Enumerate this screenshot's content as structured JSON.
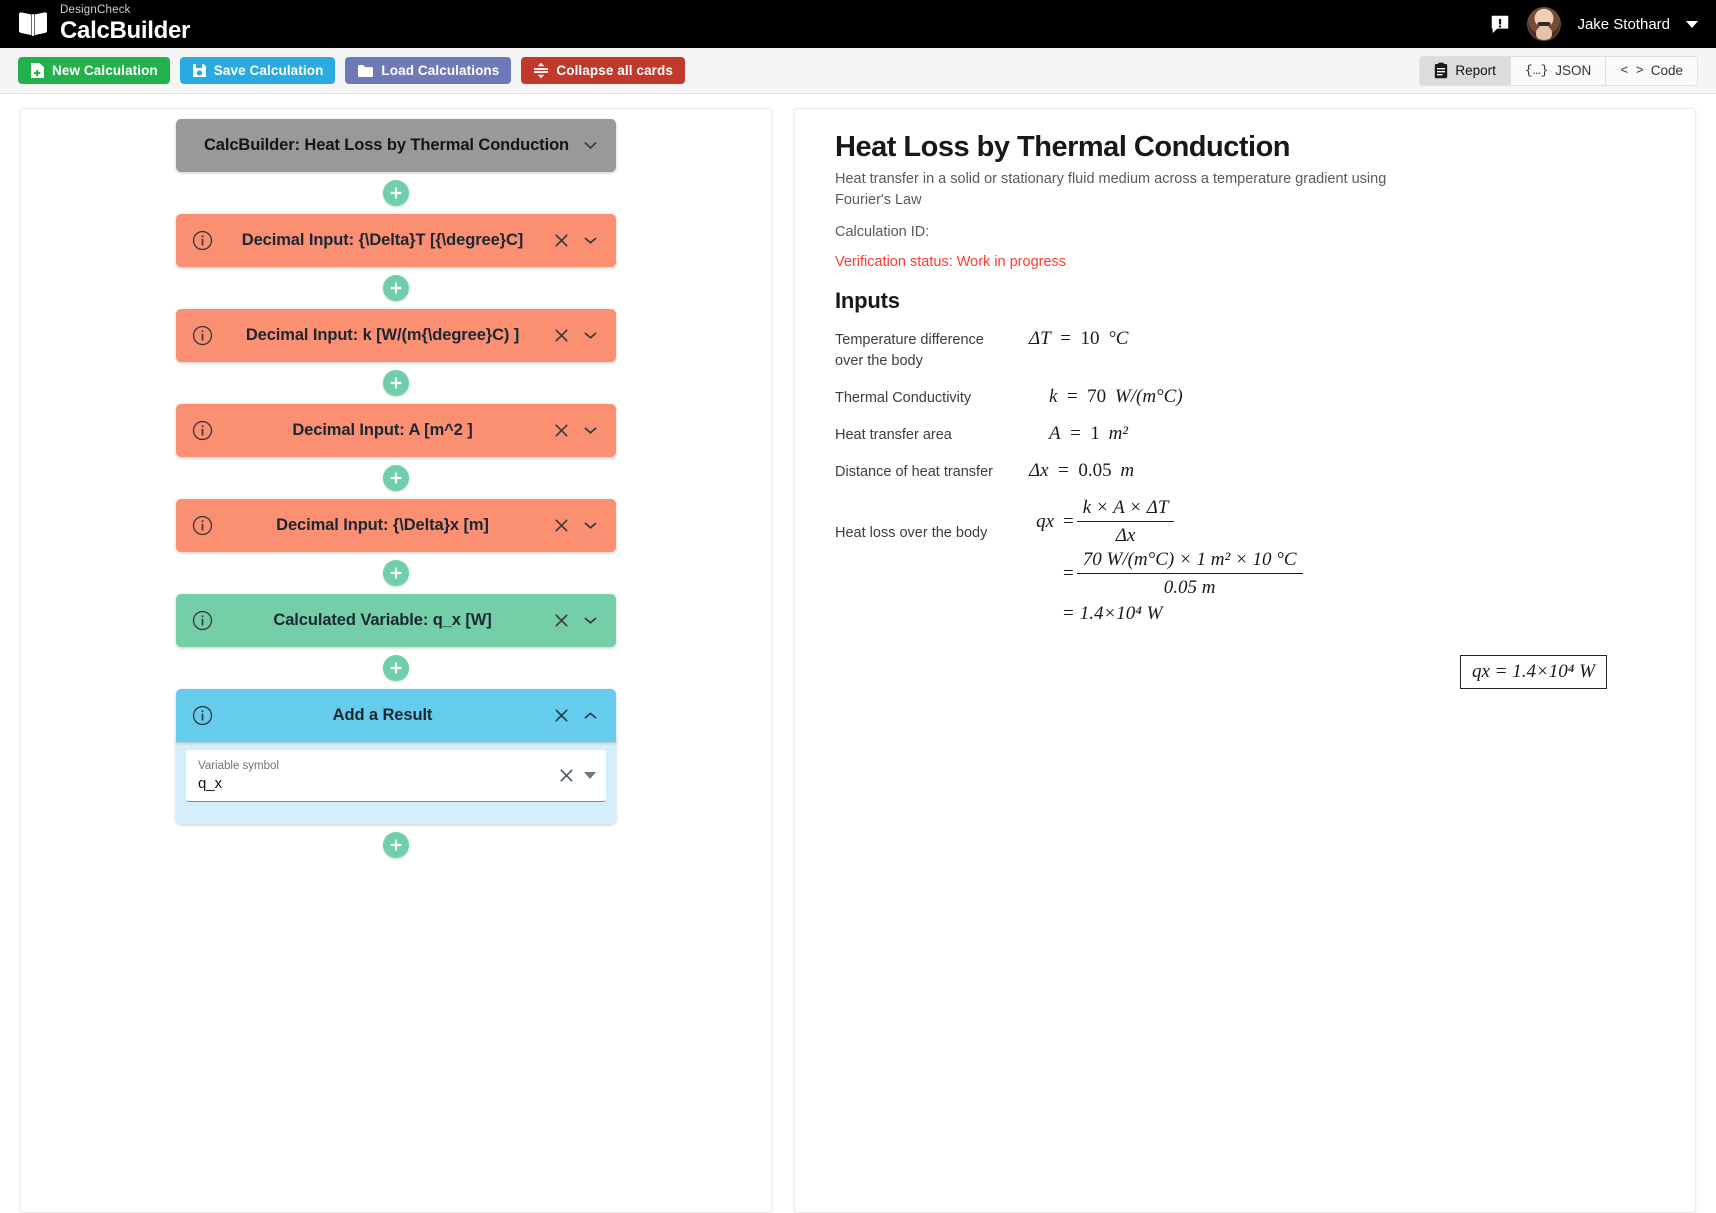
{
  "topbar": {
    "brand_sub": "DesignCheck",
    "brand_main": "CalcBuilder",
    "book_icon": "book-icon",
    "alert_icon": "alert-message-icon",
    "username": "Jake Stothard",
    "caret_icon": "chevron-down-icon"
  },
  "toolbar": {
    "new_calculation": "New Calculation",
    "save_calculation": "Save Calculation",
    "load_calculations": "Load Calculations",
    "collapse_all": "Collapse all cards",
    "views": [
      {
        "label": "Report",
        "icon": "clipboard-icon",
        "active": true
      },
      {
        "label": "JSON",
        "icon": "braces-icon",
        "active": false
      },
      {
        "label": "Code",
        "icon": "angle-brackets-icon",
        "active": false
      }
    ]
  },
  "cards": [
    {
      "title": "CalcBuilder: Heat Loss by Thermal Conduction",
      "type": "header",
      "color": "#999999",
      "has_info": false,
      "has_close": false,
      "chevron": "down"
    },
    {
      "title": "Decimal Input: {\\Delta}T [{\\degree}C]",
      "type": "input",
      "color": "#fa8f72",
      "has_info": true,
      "has_close": true,
      "chevron": "down"
    },
    {
      "title": "Decimal Input: k [W/(m{\\degree}C) ]",
      "type": "input",
      "color": "#fa8f72",
      "has_info": true,
      "has_close": true,
      "chevron": "down"
    },
    {
      "title": "Decimal Input: A [m^2 ]",
      "type": "input",
      "color": "#fa8f72",
      "has_info": true,
      "has_close": true,
      "chevron": "down"
    },
    {
      "title": "Decimal Input: {\\Delta}x [m]",
      "type": "input",
      "color": "#fa8f72",
      "has_info": true,
      "has_close": true,
      "chevron": "down"
    },
    {
      "title": "Calculated Variable: q_x [W]",
      "type": "calculated",
      "color": "#74cfa9",
      "has_info": true,
      "has_close": true,
      "chevron": "down"
    },
    {
      "title": "Add a Result",
      "type": "result",
      "color": "#65cceb",
      "has_info": true,
      "has_close": true,
      "chevron": "up",
      "expanded": true
    }
  ],
  "result_card_field": {
    "label": "Variable symbol",
    "value": "q_x",
    "clear_icon": "close-icon",
    "dropdown_icon": "chevron-down-icon"
  },
  "add_button_icon": "plus-icon",
  "report": {
    "title": "Heat Loss by Thermal Conduction",
    "description": "Heat transfer in a solid or stationary fluid medium across a temperature gradient using Fourier's Law",
    "calculation_id": "Calculation ID:",
    "verification_status": "Verification status: Work in progress",
    "status_color": "#ff3b30",
    "inputs_heading": "Inputs",
    "rows": [
      {
        "label": "Temperature difference over the body",
        "symbol": "ΔT",
        "value": "10",
        "unit": "°C"
      },
      {
        "label": "Thermal Conductivity",
        "symbol": "k",
        "value": "70",
        "unit": "W/(m°C)"
      },
      {
        "label": "Heat transfer area",
        "symbol": "A",
        "value": "1",
        "unit": "m²"
      },
      {
        "label": "Distance of heat transfer",
        "symbol": "Δx",
        "value": "0.05",
        "unit": "m"
      }
    ],
    "equation": {
      "label": "Heat loss over the body",
      "symbol": "qx",
      "symbolic_numerator": "k × A × ΔT",
      "symbolic_denominator": "Δx",
      "numeric_numerator": "70 W/(m°C) × 1 m² × 10 °C",
      "numeric_denominator": "0.05 m",
      "result": "1.4×10⁴ W"
    },
    "boxed_result": "qx = 1.4×10⁴ W"
  }
}
